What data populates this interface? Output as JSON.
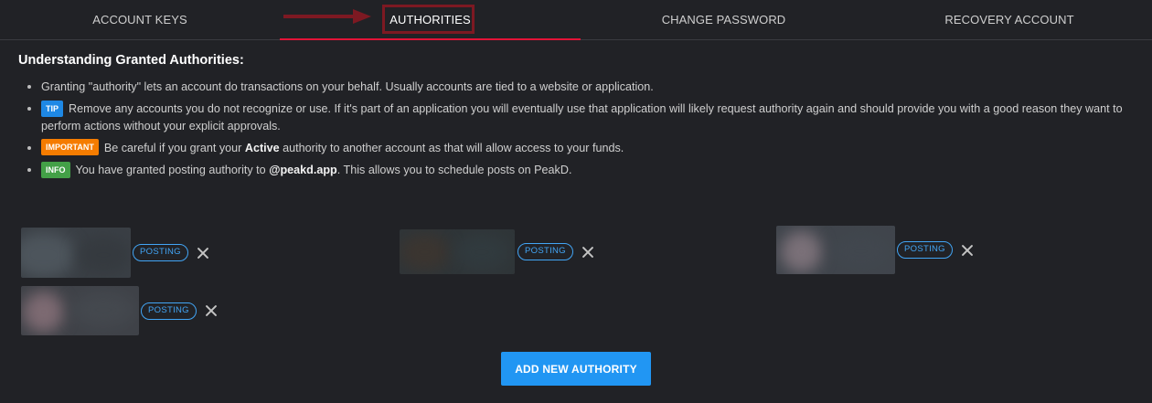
{
  "tabs": [
    {
      "label": "ACCOUNT KEYS"
    },
    {
      "label": "AUTHORITIES"
    },
    {
      "label": "CHANGE PASSWORD"
    },
    {
      "label": "RECOVERY ACCOUNT"
    }
  ],
  "active_tab": "AUTHORITIES",
  "colors": {
    "accent": "#e31337",
    "highlight_box": "#7d1922",
    "primary_button": "#2196f3",
    "tip_badge": "#1e88e5",
    "important_badge": "#f57c00",
    "info_badge": "#43a047",
    "posting_tag": "#42a5f5"
  },
  "info": {
    "heading": "Understanding Granted Authorities:",
    "bullet1": "Granting \"authority\" lets an account do transactions on your behalf. Usually accounts are tied to a website or application.",
    "tip_badge": "TIP",
    "tip_text": "Remove any accounts you do not recognize or use. If it's part of an application you will eventually use that application will likely request authority again and should provide you with a good reason they want to perform actions without your explicit approvals.",
    "important_badge": "IMPORTANT",
    "important_pre": "Be careful if you grant your ",
    "important_bold": "Active",
    "important_post": " authority to another account as that will allow access to your funds.",
    "info_badge": "INFO",
    "info_pre": "You have granted posting authority to ",
    "info_bold": "@peakd.app",
    "info_post": ". This allows you to schedule posts on PeakD."
  },
  "authorities": [
    {
      "tag": "POSTING",
      "icon": "close-icon"
    },
    {
      "tag": "POSTING",
      "icon": "close-icon"
    },
    {
      "tag": "POSTING",
      "icon": "close-icon"
    },
    {
      "tag": "POSTING",
      "icon": "close-icon"
    }
  ],
  "add_button": "ADD NEW AUTHORITY"
}
